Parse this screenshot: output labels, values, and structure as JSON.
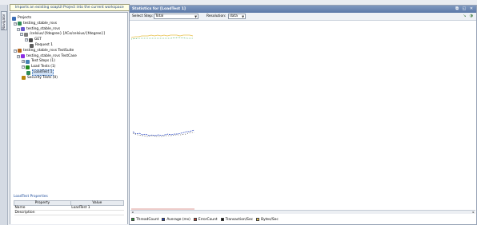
{
  "tooltip": "Imports an existing soapUI Project into the current workspace",
  "navigator_tab": "Navigator",
  "tree": [
    {
      "label": "Projects",
      "icon": "projects-icon",
      "expander": "",
      "sel": false
    },
    {
      "label": "testing_stable_rsvs",
      "icon": "project-icon",
      "expander": "−",
      "sel": false
    },
    {
      "label": "testing_stable_rsvs",
      "icon": "interface-icon",
      "expander": "−",
      "sel": false
    },
    {
      "label": "/celsius/{fdegree} [/ICo/celsius/{fdegree}]",
      "icon": "resource-icon",
      "expander": "−",
      "sel": false
    },
    {
      "label": "GET",
      "icon": "method-icon",
      "expander": "−",
      "sel": false
    },
    {
      "label": "Request 1",
      "icon": "request-icon",
      "expander": "",
      "sel": false
    },
    {
      "label": "testing_stable_rsvs TestSuite",
      "icon": "testsuite-icon",
      "expander": "−",
      "sel": false
    },
    {
      "label": "testing_stable_rsvs TestCase",
      "icon": "testcase-icon",
      "expander": "−",
      "sel": false
    },
    {
      "label": "Test Steps (1)",
      "icon": "teststeps-icon",
      "expander": "+",
      "sel": false
    },
    {
      "label": "Load Tests (1)",
      "icon": "loadtests-icon",
      "expander": "−",
      "sel": false
    },
    {
      "label": "LoadTest 1",
      "icon": "loadtest-icon",
      "expander": "",
      "sel": true
    },
    {
      "label": "Security Tests (0)",
      "icon": "securitytests-icon",
      "expander": "",
      "sel": false
    }
  ],
  "properties": {
    "header": "LoadTest Properties",
    "col_property": "Property",
    "col_value": "Value",
    "rows": [
      {
        "name": "Name",
        "value": "LoadTest 1"
      },
      {
        "name": "Description",
        "value": ""
      }
    ]
  },
  "main": {
    "title": "Statistics for [LoadTest 1]",
    "select_step_label": "Select Step:",
    "select_step_value": "Total",
    "resolution_label": "Resolution:",
    "resolution_value": "data"
  },
  "legend": [
    {
      "label": "ThreadCount",
      "color": "#2a9a3a"
    },
    {
      "label": "Average (ms)",
      "color": "#1f3fbf"
    },
    {
      "label": "ErrorCount",
      "color": "#c0392b"
    },
    {
      "label": "Transaction/Sec",
      "color": "#111111"
    },
    {
      "label": "Bytes/Sec",
      "color": "#e8c14a"
    }
  ]
}
